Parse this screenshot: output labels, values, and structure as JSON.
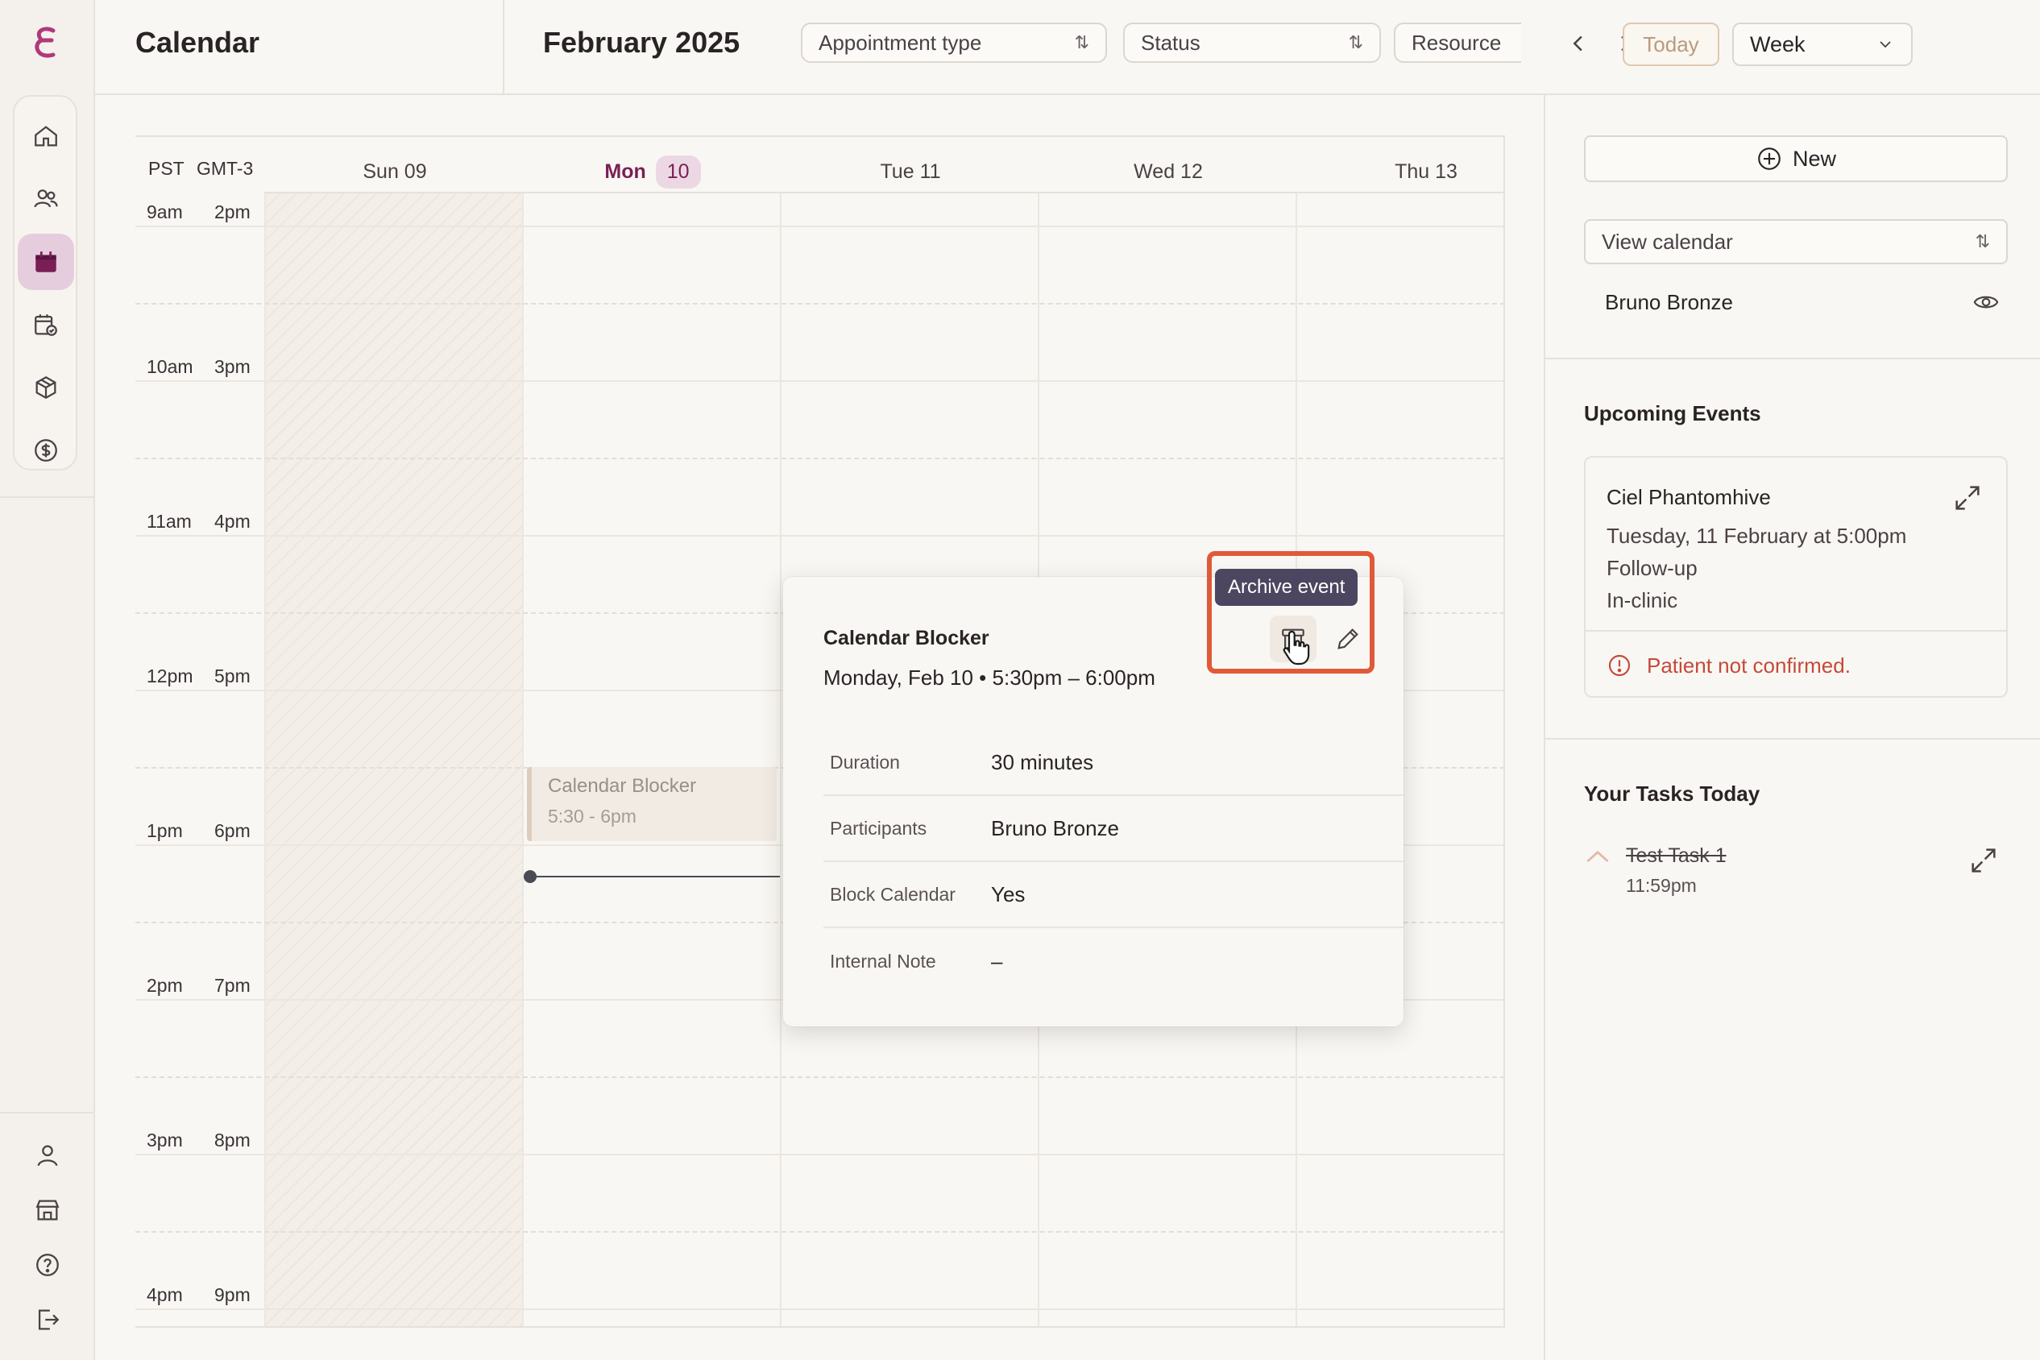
{
  "header": {
    "app_title": "Calendar",
    "month": "February 2025",
    "filters": [
      {
        "label": "Appointment type"
      },
      {
        "label": "Status"
      },
      {
        "label": "Resource"
      }
    ],
    "today_label": "Today",
    "view_select": "Week"
  },
  "calendar": {
    "timezones": [
      "PST",
      "GMT-3"
    ],
    "days": [
      {
        "label": "Sun 09"
      },
      {
        "label": "Mon",
        "num": "10"
      },
      {
        "label": "Tue 11"
      },
      {
        "label": "Wed 12"
      },
      {
        "label": "Thu 13"
      }
    ],
    "hours": [
      {
        "pst": "9am",
        "gmt": "2pm"
      },
      {
        "pst": "10am",
        "gmt": "3pm"
      },
      {
        "pst": "11am",
        "gmt": "4pm"
      },
      {
        "pst": "12pm",
        "gmt": "5pm"
      },
      {
        "pst": "1pm",
        "gmt": "6pm"
      },
      {
        "pst": "2pm",
        "gmt": "7pm"
      },
      {
        "pst": "3pm",
        "gmt": "8pm"
      },
      {
        "pst": "4pm",
        "gmt": "9pm"
      }
    ],
    "event": {
      "title": "Calendar Blocker",
      "time": "5:30 - 6pm"
    }
  },
  "popover": {
    "title": "Calendar Blocker",
    "subtitle": "Monday, Feb 10 • 5:30pm – 6:00pm",
    "tooltip": "Archive event",
    "rows": [
      {
        "key": "Duration",
        "value": "30 minutes"
      },
      {
        "key": "Participants",
        "value": "Bruno Bronze"
      },
      {
        "key": "Block Calendar",
        "value": "Yes"
      },
      {
        "key": "Internal Note",
        "value": "–"
      }
    ]
  },
  "right_panel": {
    "new_label": "New",
    "view_calendar": "View calendar",
    "person": "Bruno Bronze",
    "upcoming_title": "Upcoming Events",
    "upcoming": {
      "name": "Ciel Phantomhive",
      "when": "Tuesday, 11 February at 5:00pm",
      "type": "Follow-up",
      "location": "In-clinic",
      "warning": "Patient not confirmed."
    },
    "tasks_title": "Your Tasks Today",
    "task": {
      "name": "Test Task 1",
      "time": "11:59pm"
    }
  },
  "colors": {
    "accent": "#7a1f56",
    "highlight": "#e05a3a",
    "warning": "#c44a3a",
    "tooltip": "#4d4660"
  }
}
